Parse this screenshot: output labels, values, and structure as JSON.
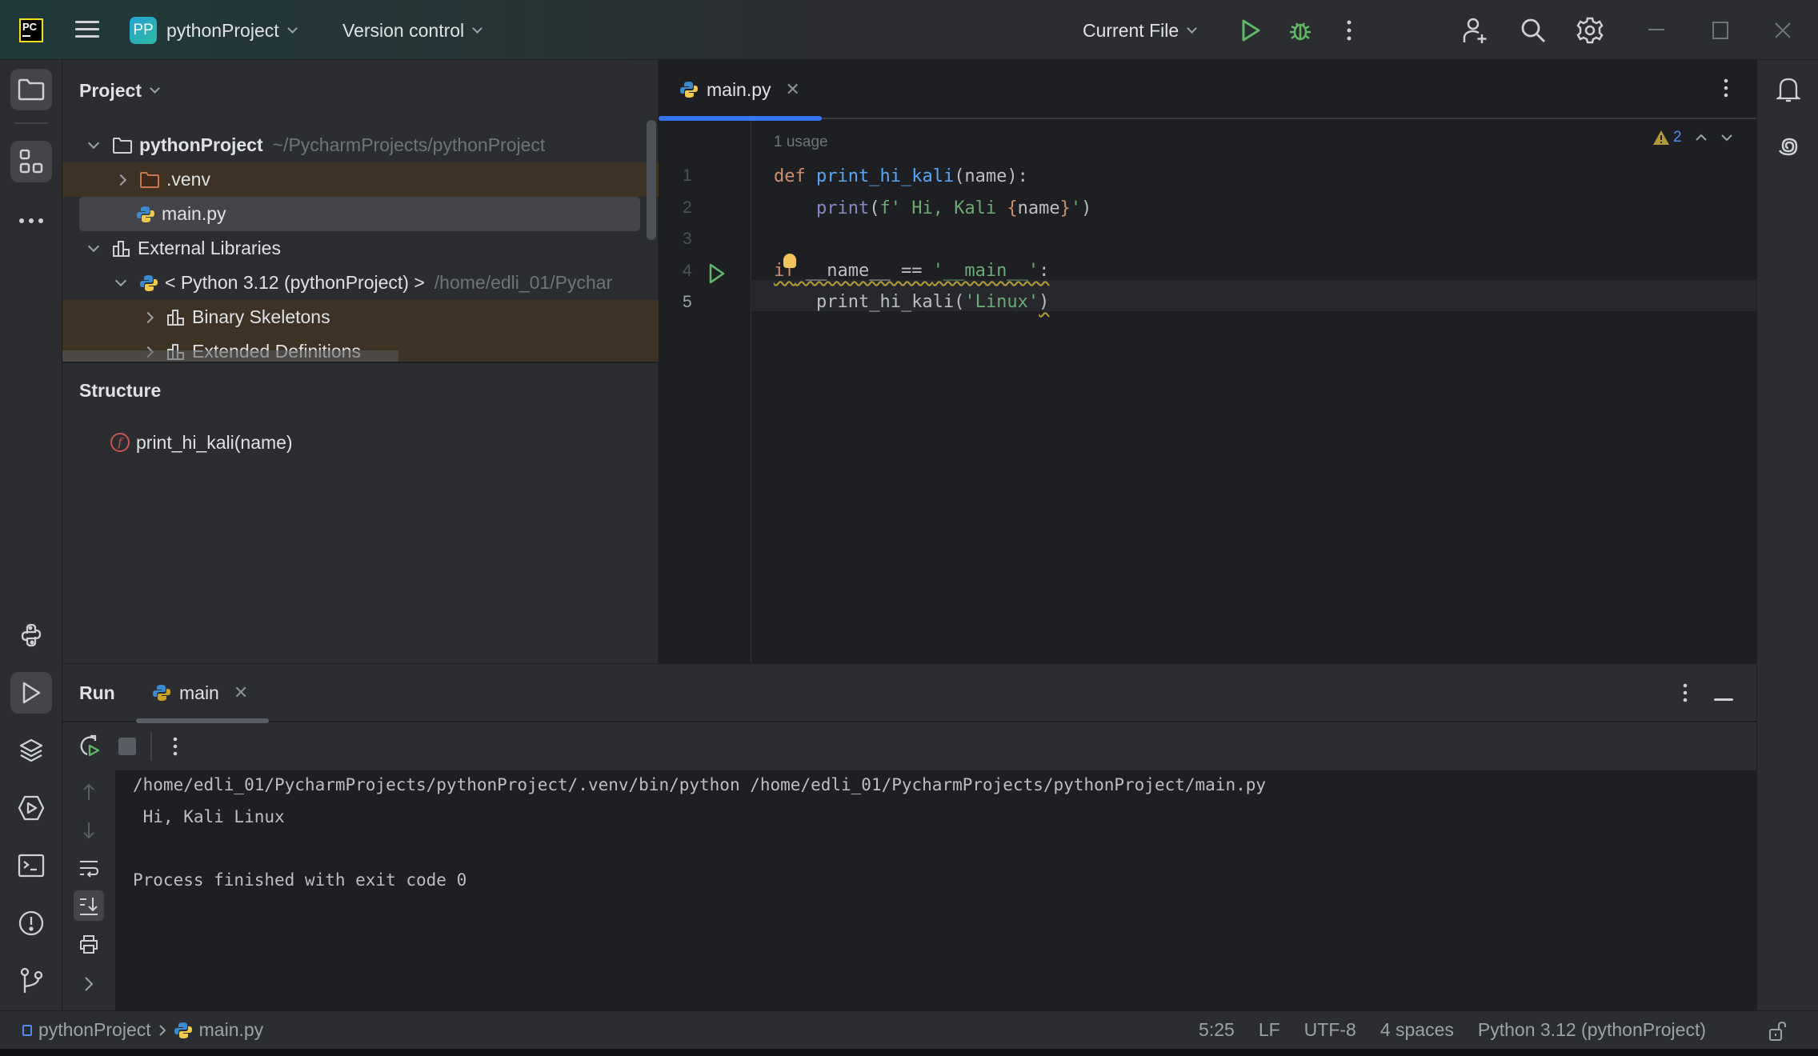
{
  "titlebar": {
    "logo": "PC",
    "project_badge": "PP",
    "project_name": "pythonProject",
    "vcs_label": "Version control",
    "run_config": "Current File",
    "icons": [
      "run-icon",
      "debug-icon",
      "more-vertical-icon",
      "add-user-icon",
      "search-icon",
      "settings-icon",
      "minimize-icon",
      "maximize-icon",
      "close-icon"
    ]
  },
  "left_stripe": {
    "top": [
      "project-folder-icon",
      "structure-icon",
      "more-horizontal-icon"
    ],
    "bottom": [
      "python-console-icon",
      "run-icon",
      "layers-icon",
      "services-icon",
      "terminal-icon",
      "problems-icon",
      "git-icon"
    ]
  },
  "right_stripe": [
    "notifications-bell-icon",
    "ai-assistant-spiral-icon"
  ],
  "project_panel": {
    "title": "Project",
    "tree": [
      {
        "label": "pythonProject",
        "hint": "~/PycharmProjects/pythonProject",
        "expanded": true,
        "icon": "folder-icon",
        "depth": 0
      },
      {
        "label": ".venv",
        "expanded": false,
        "icon": "excluded-folder-icon",
        "depth": 1,
        "excluded": true
      },
      {
        "label": "main.py",
        "icon": "python-file-icon",
        "depth": 1,
        "selected": true
      },
      {
        "label": "External Libraries",
        "expanded": true,
        "icon": "library-icon",
        "depth": 0
      },
      {
        "label": "< Python 3.12 (pythonProject) >",
        "hint": "/home/edli_01/Pychar",
        "expanded": true,
        "icon": "python-sdk-icon",
        "depth": 1
      },
      {
        "label": "Binary Skeletons",
        "expanded": false,
        "icon": "library-icon",
        "depth": 2,
        "excluded": true
      },
      {
        "label": "Extended Definitions",
        "expanded": false,
        "icon": "library-icon",
        "depth": 2,
        "excluded": true
      }
    ],
    "structure_title": "Structure",
    "structure_items": [
      {
        "label": "print_hi_kali(name)",
        "kind": "f"
      }
    ]
  },
  "editor": {
    "tab_label": "main.py",
    "usage_hint": "1 usage",
    "warnings_count": "2",
    "line_numbers": [
      "1",
      "2",
      "3",
      "4",
      "5"
    ],
    "current_line": 5,
    "lines": {
      "l1_kw": "def",
      "l1_fn": "print_hi_kali",
      "l1_rest": "(name):",
      "l2_indent": "    ",
      "l2_builtin": "print",
      "l2_open": "(",
      "l2_fprefix": "f'",
      "l2_str": " Hi, Kali ",
      "l2_brace_open": "{",
      "l2_var": "name",
      "l2_brace_close": "}",
      "l2_str_end": "'",
      "l2_close": ")",
      "l4_kw": "if",
      "l4_rest": " __name__ == ",
      "l4_str": "'__main__'",
      "l4_colon": ":",
      "l5_indent": "    ",
      "l5_call": "print_hi_kali(",
      "l5_str": "'Linux'",
      "l5_close": ")"
    }
  },
  "run_window": {
    "title": "Run",
    "tab_label": "main",
    "console": [
      "/home/edli_01/PycharmProjects/pythonProject/.venv/bin/python /home/edli_01/PycharmProjects/pythonProject/main.py",
      " Hi, Kali Linux",
      "",
      "Process finished with exit code 0"
    ]
  },
  "statusbar": {
    "breadcrumb": [
      "pythonProject",
      "main.py"
    ],
    "caret_position": "5:25",
    "line_separator": "LF",
    "encoding": "UTF-8",
    "indent": "4 spaces",
    "interpreter": "Python 3.12 (pythonProject)"
  },
  "colors": {
    "accent": "#3574f0",
    "run_green": "#5fb865",
    "warning": "#b0993b",
    "excluded_bg": "#3d3223"
  }
}
